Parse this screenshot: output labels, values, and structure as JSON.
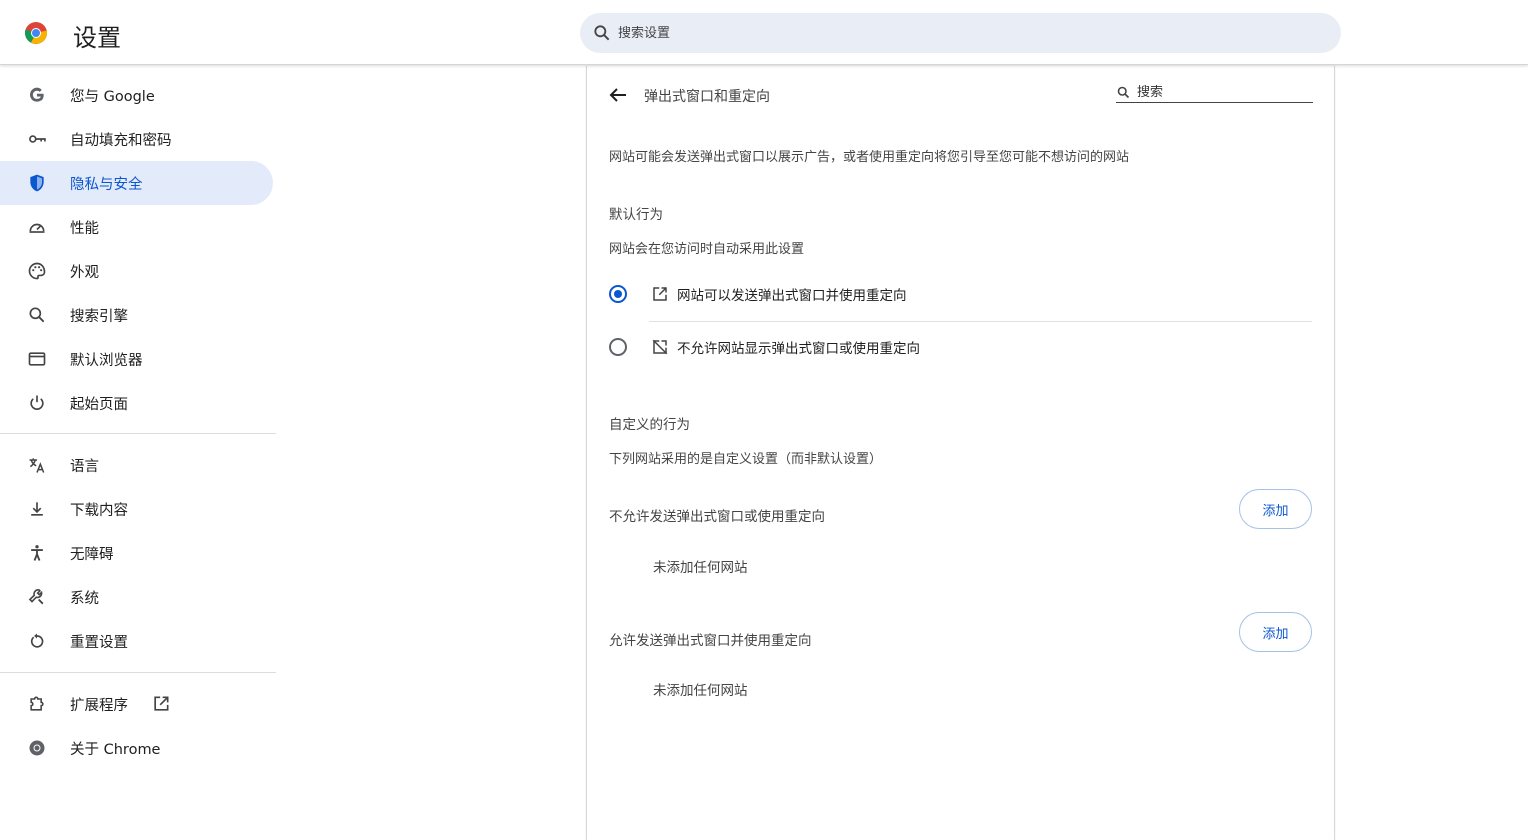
{
  "header": {
    "title": "设置",
    "search_placeholder": "搜索设置"
  },
  "sidebar": {
    "items": [
      {
        "label": "您与 Google",
        "icon": "google-g-icon"
      },
      {
        "label": "自动填充和密码",
        "icon": "key-icon"
      },
      {
        "label": "隐私与安全",
        "icon": "shield-icon",
        "active": true
      },
      {
        "label": "性能",
        "icon": "speedometer-icon"
      },
      {
        "label": "外观",
        "icon": "palette-icon"
      },
      {
        "label": "搜索引擎",
        "icon": "search-icon"
      },
      {
        "label": "默认浏览器",
        "icon": "browser-window-icon"
      },
      {
        "label": "起始页面",
        "icon": "power-icon"
      },
      {
        "label": "语言",
        "icon": "translate-icon"
      },
      {
        "label": "下载内容",
        "icon": "download-icon"
      },
      {
        "label": "无障碍",
        "icon": "accessibility-icon"
      },
      {
        "label": "系统",
        "icon": "wrench-icon"
      },
      {
        "label": "重置设置",
        "icon": "reset-icon"
      },
      {
        "label": "扩展程序",
        "icon": "extension-puzzle-icon"
      },
      {
        "label": "关于 Chrome",
        "icon": "chrome-icon"
      }
    ]
  },
  "page": {
    "title": "弹出式窗口和重定向",
    "search_placeholder": "搜索",
    "description": "网站可能会发送弹出式窗口以展示广告，或者使用重定向将您引导至您可能不想访问的网站",
    "default_behavior": {
      "heading": "默认行为",
      "subtext": "网站会在您访问时自动采用此设置",
      "options": [
        {
          "label": "网站可以发送弹出式窗口并使用重定向",
          "icon": "open-in-new-icon",
          "checked": true
        },
        {
          "label": "不允许网站显示弹出式窗口或使用重定向",
          "icon": "popup-blocked-icon",
          "checked": false
        }
      ]
    },
    "custom_behavior": {
      "heading": "自定义的行为",
      "subtext": "下列网站采用的是自定义设置（而非默认设置）",
      "block": {
        "label": "不允许发送弹出式窗口或使用重定向",
        "add_label": "添加",
        "empty": "未添加任何网站"
      },
      "allow": {
        "label": "允许发送弹出式窗口并使用重定向",
        "add_label": "添加",
        "empty": "未添加任何网站"
      }
    }
  },
  "colors": {
    "accent": "#0b57d0",
    "active_bg": "#e3eaf9",
    "search_bg": "#e9eef6"
  }
}
